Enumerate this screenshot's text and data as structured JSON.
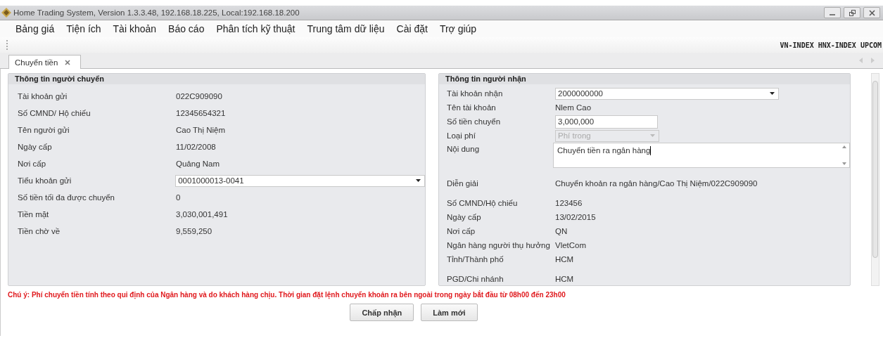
{
  "window": {
    "title": "Home Trading System, Version 1.3.3.48, 192.168.18.225, Local:192.168.18.200"
  },
  "menu": [
    "Bảng giá",
    "Tiện ích",
    "Tài khoản",
    "Báo cáo",
    "Phân tích kỹ thuật",
    "Trung tâm dữ liệu",
    "Cài đặt",
    "Trợ giúp"
  ],
  "indexes": [
    "VN-INDEX",
    "HNX-INDEX",
    "UPCOM"
  ],
  "tabs": [
    {
      "label": "Chuyển tiền",
      "selected": true
    }
  ],
  "sender": {
    "title": "Thông tin người chuyển",
    "rows": [
      {
        "kind": "text",
        "label": "Tài khoản gửi",
        "value": "022C909090"
      },
      {
        "kind": "text",
        "label": "Số CMND/ Hộ chiếu",
        "value": "12345654321"
      },
      {
        "kind": "text",
        "label": "Tên người gửi",
        "value": "Cao Thị Niệm"
      },
      {
        "kind": "text",
        "label": "Ngày cấp",
        "value": "11/02/2008"
      },
      {
        "kind": "text",
        "label": "Nơi cấp",
        "value": "Quảng Nam"
      },
      {
        "kind": "combo",
        "label": "Tiểu khoản gửi",
        "value": "0001000013-0041",
        "disabled": false
      },
      {
        "kind": "text",
        "label": "Số tiền tối đa được chuyển",
        "value": "0"
      },
      {
        "kind": "text",
        "label": "Tiền mặt",
        "value": "3,030,001,491"
      },
      {
        "kind": "text",
        "label": "Tiền chờ về",
        "value": "9,559,250"
      }
    ]
  },
  "receiver": {
    "title": "Thông tin người nhận",
    "rows": [
      {
        "kind": "combo",
        "label": "Tài khoản nhận",
        "value": "2000000000",
        "disabled": false
      },
      {
        "kind": "text",
        "label": "Tên tài khoản",
        "value": "Nlem Cao"
      },
      {
        "kind": "input",
        "label": "Số tiền chuyển",
        "value": "3,000,000"
      },
      {
        "kind": "combo-small",
        "label": "Loại phí",
        "value": "Phí trong",
        "disabled": true
      },
      {
        "kind": "textarea",
        "label": "Nội dung",
        "value": "Chuyển tiền ra ngân hàng"
      },
      {
        "kind": "text",
        "label": "Diễn giải",
        "value": "Chuyển khoản ra ngân hàng/Cao Thị Niệm/022C909090",
        "gap": true
      },
      {
        "kind": "text",
        "label": "Số CMND/Hộ chiếu",
        "value": "123456",
        "gap": true
      },
      {
        "kind": "text",
        "label": "Ngày cấp",
        "value": "13/02/2015"
      },
      {
        "kind": "text",
        "label": "Nơi cấp",
        "value": "QN"
      },
      {
        "kind": "text",
        "label": "Ngân hàng người thụ hưởng",
        "value": "VletCom"
      },
      {
        "kind": "text",
        "label": "Tỉnh/Thành phố",
        "value": "HCM"
      },
      {
        "kind": "text",
        "label": "PGD/Chi nhánh",
        "value": "HCM",
        "gap": true
      }
    ]
  },
  "notice": "Chú ý: Phí chuyển tiền tính theo qui định của Ngân hàng và do khách hàng chịu. Thời gian đặt lệnh chuyển khoản ra bên ngoài trong ngày bắt đầu từ 08h00 đến 23h00",
  "buttons": [
    "Chấp nhận",
    "Làm mới"
  ]
}
